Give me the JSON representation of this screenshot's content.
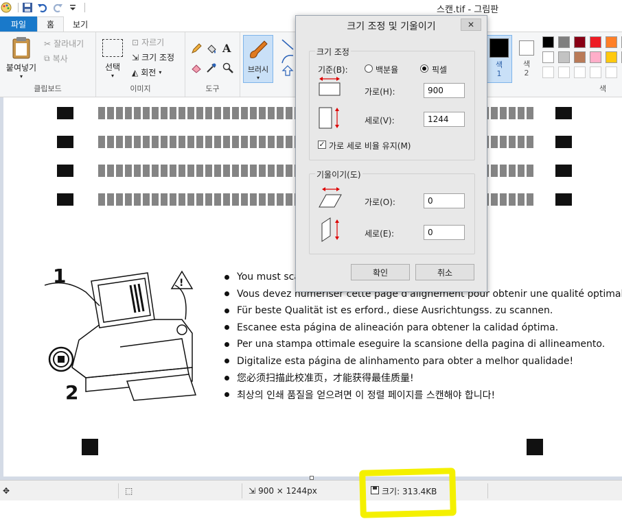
{
  "window": {
    "title": "스캔.tif - 그림판"
  },
  "tabs": [
    {
      "label": "파일"
    },
    {
      "label": "홈"
    },
    {
      "label": "보기"
    }
  ],
  "ribbon": {
    "clipboard": {
      "paste": "붙여넣기",
      "cut": "잘라내기",
      "copy": "복사",
      "label": "클립보드"
    },
    "image": {
      "select": "선택",
      "crop": "자르기",
      "resize": "크기 조정",
      "rotate": "회전",
      "label": "이미지"
    },
    "tools": {
      "label": "도구"
    },
    "brushes": {
      "label": "브러시"
    },
    "color1": "색\n1",
    "color2": "색\n2",
    "colors_label": "색",
    "palette": [
      "#000000",
      "#7f7f7f",
      "#880015",
      "#ed1c24",
      "#ff7f27",
      "#fff200",
      "#ffffff",
      "#c3c3c3",
      "#b97a57",
      "#ffaec9",
      "#ffc90e",
      "#efe4b0"
    ]
  },
  "document": {
    "steps": [
      "1",
      "2"
    ],
    "bullets": [
      "You must scan this page...",
      "Vous devez numériser cette page d'alignement pour obtenir une qualité optimale.",
      "Für beste Qualität ist es erford., diese Ausrichtungss. zu scannen.",
      "Escanee esta página de alineación para obtener la calidad óptima.",
      "Per una stampa ottimale eseguire la scansione della pagina di allineamento.",
      "Digitalize esta página de alinhamento para obter a melhor qualidade!",
      "您必须扫描此校准页，才能获得最佳质量!",
      "최상의 인쇄 품질을 얻으려면 이 정렬 페이지를 스캔해야 합니다!"
    ]
  },
  "statusbar": {
    "dimensions": "900 × 1244px",
    "size": "크기: 313.4KB"
  },
  "dialog": {
    "title": "크기 조정 및 기울이기",
    "close": "✕",
    "resize": {
      "legend": "크기 조정",
      "basis": "기준(B):",
      "percent": "백분율",
      "pixels": "픽셀",
      "horizontal_label": "가로(H):",
      "horizontal_value": "900",
      "vertical_label": "세로(V):",
      "vertical_value": "1244",
      "keep_ratio": "가로 세로 비율 유지(M)"
    },
    "skew": {
      "legend": "기울이기(도)",
      "horizontal_label": "가로(O):",
      "horizontal_value": "0",
      "vertical_label": "세로(E):",
      "vertical_value": "0"
    },
    "ok": "확인",
    "cancel": "취소"
  }
}
